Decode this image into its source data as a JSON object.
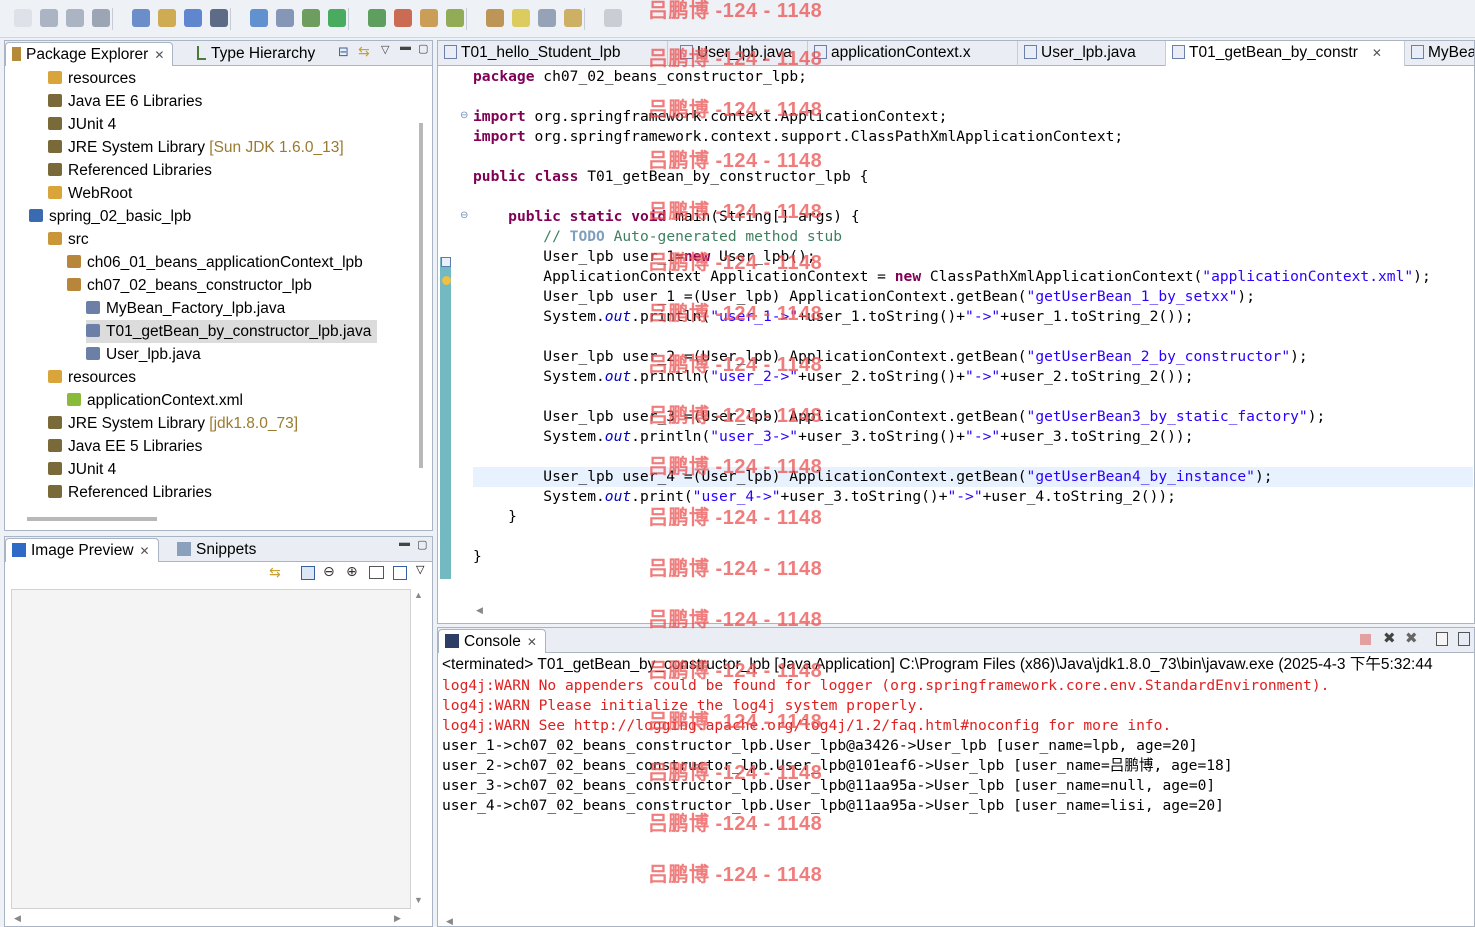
{
  "toolbar": {
    "buttons": [
      "new-icon",
      "save-icon",
      "save-all-icon",
      "print-icon",
      "new-wizard-icon",
      "build-icon",
      "package-icon",
      "web-icon",
      "tomcat-icon",
      "search-icon",
      "debug-icon",
      "run-icon",
      "run-history-icon",
      "external-tools-icon",
      "open-type-icon",
      "open-task-icon",
      "toggle-annotation-icon",
      "next-annotation-icon",
      "prev-annotation-icon",
      "back-icon",
      "forward-icon"
    ]
  },
  "package_explorer": {
    "tabs": [
      {
        "label": "Package Explorer",
        "active": true
      },
      {
        "label": "Type Hierarchy",
        "active": false
      }
    ],
    "tree": [
      {
        "label": "resources",
        "icon": "folder-icon",
        "indent": 1,
        "decoration": ""
      },
      {
        "label": "Java EE 6 Libraries",
        "icon": "library-icon",
        "indent": 1,
        "decoration": ""
      },
      {
        "label": "JUnit 4",
        "icon": "library-icon",
        "indent": 1,
        "decoration": ""
      },
      {
        "label": "JRE System Library",
        "icon": "library-icon",
        "indent": 1,
        "decoration": "[Sun JDK 1.6.0_13]"
      },
      {
        "label": "Referenced Libraries",
        "icon": "library-icon",
        "indent": 1,
        "decoration": ""
      },
      {
        "label": "WebRoot",
        "icon": "folder-icon",
        "indent": 1,
        "decoration": ""
      },
      {
        "label": "spring_02_basic_lpb",
        "icon": "project-icon",
        "indent": 0,
        "decoration": ""
      },
      {
        "label": "src",
        "icon": "source-folder-icon",
        "indent": 1,
        "decoration": ""
      },
      {
        "label": "ch06_01_beans_applicationContext_lpb",
        "icon": "package-icon",
        "indent": 2,
        "decoration": ""
      },
      {
        "label": "ch07_02_beans_constructor_lpb",
        "icon": "package-icon",
        "indent": 2,
        "decoration": ""
      },
      {
        "label": "MyBean_Factory_lpb.java",
        "icon": "java-file-icon",
        "indent": 3,
        "decoration": ""
      },
      {
        "label": "T01_getBean_by_constructor_lpb.java",
        "icon": "java-file-icon",
        "indent": 3,
        "decoration": "",
        "selected": true
      },
      {
        "label": "User_lpb.java",
        "icon": "java-file-icon",
        "indent": 3,
        "decoration": ""
      },
      {
        "label": "resources",
        "icon": "folder-icon",
        "indent": 1,
        "decoration": ""
      },
      {
        "label": "applicationContext.xml",
        "icon": "xml-file-icon",
        "indent": 2,
        "decoration": ""
      },
      {
        "label": "JRE System Library",
        "icon": "library-icon",
        "indent": 1,
        "decoration": "[jdk1.8.0_73]"
      },
      {
        "label": "Java EE 5 Libraries",
        "icon": "library-icon",
        "indent": 1,
        "decoration": ""
      },
      {
        "label": "JUnit 4",
        "icon": "library-icon",
        "indent": 1,
        "decoration": ""
      },
      {
        "label": "Referenced Libraries",
        "icon": "library-icon",
        "indent": 1,
        "decoration": ""
      }
    ]
  },
  "image_preview": {
    "tabs": [
      {
        "label": "Image Preview",
        "active": true
      },
      {
        "label": "Snippets",
        "active": false
      }
    ]
  },
  "editor": {
    "tabs": [
      {
        "label": "T01_hello_Student_lpb",
        "active": false
      },
      {
        "label": "User_lpb.java",
        "active": false
      },
      {
        "label": "applicationContext.x",
        "active": false
      },
      {
        "label": "User_lpb.java",
        "active": false
      },
      {
        "label": "T01_getBean_by_constr",
        "active": true
      },
      {
        "label": "MyBea",
        "active": false
      }
    ],
    "code_lines": [
      [
        [
          "kw",
          "package"
        ],
        [
          "p",
          " ch07_02_beans_constructor_lpb;"
        ]
      ],
      [],
      [
        [
          "kw",
          "import"
        ],
        [
          "p",
          " org.springframework.context.ApplicationContext;"
        ]
      ],
      [
        [
          "kw",
          "import"
        ],
        [
          "p",
          " org.springframework.context.support.ClassPathXmlApplicationContext;"
        ]
      ],
      [],
      [
        [
          "kw",
          "public"
        ],
        [
          "p",
          " "
        ],
        [
          "kw",
          "class"
        ],
        [
          "p",
          " T01_getBean_by_constructor_lpb {"
        ]
      ],
      [],
      [
        [
          "p",
          "    "
        ],
        [
          "kw",
          "public"
        ],
        [
          "p",
          " "
        ],
        [
          "kw",
          "static"
        ],
        [
          "p",
          " "
        ],
        [
          "kw",
          "void"
        ],
        [
          "p",
          " main(String[] args) {"
        ]
      ],
      [
        [
          "p",
          "        "
        ],
        [
          "cmt",
          "// "
        ],
        [
          "todo",
          "TODO"
        ],
        [
          "cmt",
          " Auto-generated method stub"
        ]
      ],
      [
        [
          "p",
          "        User_lpb user_1="
        ],
        [
          "kw",
          "new"
        ],
        [
          "p",
          " User_lpb();"
        ]
      ],
      [
        [
          "p",
          "        ApplicationContext ApplicationContext = "
        ],
        [
          "kw",
          "new"
        ],
        [
          "p",
          " ClassPathXmlApplicationContext("
        ],
        [
          "str",
          "\"applicationContext.xml\""
        ],
        [
          "p",
          ");"
        ]
      ],
      [
        [
          "p",
          "        User_lpb user_1 =(User_lpb) ApplicationContext.getBean("
        ],
        [
          "str",
          "\"getUserBean_1_by_setxx\""
        ],
        [
          "p",
          ");"
        ]
      ],
      [
        [
          "p",
          "        System."
        ],
        [
          "it",
          "out"
        ],
        [
          "p",
          ".println("
        ],
        [
          "str",
          "\"user_1->\""
        ],
        [
          "p",
          "+user_1.toString()+"
        ],
        [
          "str",
          "\"->\""
        ],
        [
          "p",
          "+user_1.toString_2());"
        ]
      ],
      [],
      [
        [
          "p",
          "        User_lpb user_2 =(User_lpb) ApplicationContext.getBean("
        ],
        [
          "str",
          "\"getUserBean_2_by_constructor\""
        ],
        [
          "p",
          ");"
        ]
      ],
      [
        [
          "p",
          "        System."
        ],
        [
          "it",
          "out"
        ],
        [
          "p",
          ".println("
        ],
        [
          "str",
          "\"user_2->\""
        ],
        [
          "p",
          "+user_2.toString()+"
        ],
        [
          "str",
          "\"->\""
        ],
        [
          "p",
          "+user_2.toString_2());"
        ]
      ],
      [],
      [
        [
          "p",
          "        User_lpb user_3 =(User_lpb) ApplicationContext.getBean("
        ],
        [
          "str",
          "\"getUserBean3_by_static_factory\""
        ],
        [
          "p",
          ");"
        ]
      ],
      [
        [
          "p",
          "        System."
        ],
        [
          "it",
          "out"
        ],
        [
          "p",
          ".println("
        ],
        [
          "str",
          "\"user_3->\""
        ],
        [
          "p",
          "+user_3.toString()+"
        ],
        [
          "str",
          "\"->\""
        ],
        [
          "p",
          "+user_3.toString_2());"
        ]
      ],
      [],
      [
        [
          "p",
          "        User_lpb user_4 =(User_lpb) ApplicationContext.getBean("
        ],
        [
          "str",
          "\"getUserBean4_by_instance\""
        ],
        [
          "p",
          ");"
        ]
      ],
      [
        [
          "p",
          "        System."
        ],
        [
          "it",
          "out"
        ],
        [
          "p",
          ".print("
        ],
        [
          "str",
          "\"user_4->\""
        ],
        [
          "p",
          "+user_3.toString()+"
        ],
        [
          "str",
          "\"->\""
        ],
        [
          "p",
          "+user_4.toString_2());"
        ]
      ],
      [
        [
          "p",
          "    }"
        ]
      ],
      [],
      [
        [
          "p",
          "}"
        ]
      ]
    ],
    "current_line": 20
  },
  "console": {
    "tab_label": "Console",
    "status": "<terminated> T01_getBean_by_constructor_lpb [Java Application] C:\\Program Files (x86)\\Java\\jdk1.8.0_73\\bin\\javaw.exe (2025-4-3 下午5:32:44",
    "lines": [
      {
        "text": "log4j:WARN No appenders could be found for logger (org.springframework.core.env.StandardEnvironment).",
        "error": true
      },
      {
        "text": "log4j:WARN Please initialize the log4j system properly.",
        "error": true
      },
      {
        "text": "log4j:WARN See http://logging.apache.org/log4j/1.2/faq.html#noconfig for more info.",
        "error": true
      },
      {
        "text": "user_1->ch07_02_beans_constructor_lpb.User_lpb@a3426->User_lpb [user_name=lpb, age=20]",
        "error": false
      },
      {
        "text": "user_2->ch07_02_beans_constructor_lpb.User_lpb@101eaf6->User_lpb [user_name=吕鹏博, age=18]",
        "error": false
      },
      {
        "text": "user_3->ch07_02_beans_constructor_lpb.User_lpb@11aa95a->User_lpb [user_name=null, age=0]",
        "error": false
      },
      {
        "text": "user_4->ch07_02_beans_constructor_lpb.User_lpb@11aa95a->User_lpb [user_name=lisi, age=20]",
        "error": false
      }
    ]
  },
  "watermark": {
    "text": "吕鹏博 -124 - 1148",
    "color": "#eb5050"
  },
  "colors": {
    "keyword": "#7f0055",
    "string": "#2a00ff",
    "comment": "#3f7f5f",
    "error": "#e02020",
    "gutter": "#73b9c2"
  }
}
